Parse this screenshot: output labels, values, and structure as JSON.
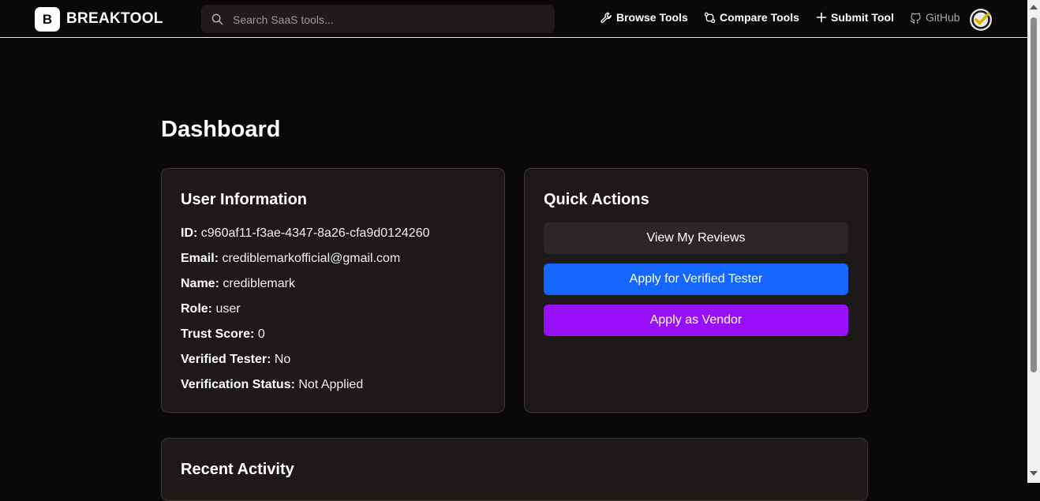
{
  "brand": {
    "logo_letter": "B",
    "name": "BREAKTOOL"
  },
  "search": {
    "placeholder": "Search SaaS tools...",
    "icon": "search-icon"
  },
  "nav": {
    "browse": "Browse Tools",
    "compare": "Compare Tools",
    "submit": "Submit Tool",
    "github": "GitHub"
  },
  "page": {
    "title": "Dashboard"
  },
  "user_info": {
    "title": "User Information",
    "rows": [
      {
        "label": "ID:",
        "value": "c960af11-f3ae-4347-8a26-cfa9d0124260"
      },
      {
        "label": "Email:",
        "value": "crediblemarkofficial@gmail.com"
      },
      {
        "label": "Name:",
        "value": "crediblemark"
      },
      {
        "label": "Role:",
        "value": "user"
      },
      {
        "label": "Trust Score:",
        "value": "0"
      },
      {
        "label": "Verified Tester:",
        "value": "No"
      },
      {
        "label": "Verification Status:",
        "value": "Not Applied"
      }
    ]
  },
  "quick_actions": {
    "title": "Quick Actions",
    "view_reviews": "View My Reviews",
    "apply_tester": "Apply for Verified Tester",
    "apply_vendor": "Apply as Vendor"
  },
  "recent_activity": {
    "title": "Recent Activity"
  },
  "colors": {
    "background": "#0b0908",
    "card": "#1c1918",
    "neutral_button": "#2a2726",
    "tester_button": "#1565ff",
    "vendor_button": "#9810fa"
  }
}
